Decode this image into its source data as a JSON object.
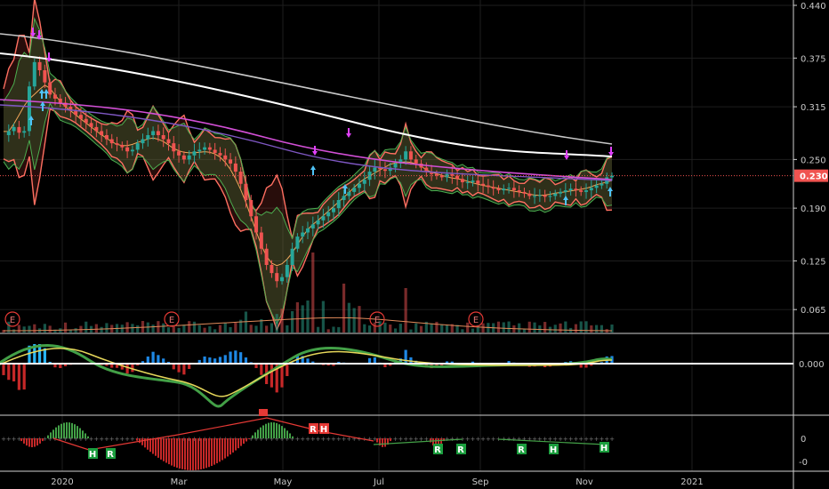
{
  "chart_data": {
    "type": "candlestick",
    "symbol_note": "",
    "price_axis": {
      "ticks": [
        "0.440",
        "0.375",
        "0.315",
        "0.250",
        "0.190",
        "0.125",
        "0.065"
      ],
      "ylim": [
        0.04,
        0.44
      ]
    },
    "last_price": {
      "label": "0.230",
      "value": 0.23,
      "color": "#f05350"
    },
    "time_axis": {
      "labels": [
        "2020",
        "Mar",
        "May",
        "Jul",
        "Sep",
        "Nov",
        "2021"
      ]
    },
    "earnings_markers": {
      "label": "E",
      "count": 4
    },
    "macd_panel": {
      "zero_label": "0.000"
    },
    "osc_panel": {
      "ticks": [
        "0",
        "-0"
      ]
    },
    "signal_tags": [
      {
        "label": "H",
        "color": "#1b9e3e"
      },
      {
        "label": "R",
        "color": "#1b9e3e"
      },
      {
        "label": "R",
        "color": "#e53935"
      },
      {
        "label": "H",
        "color": "#e53935"
      },
      {
        "label": "R",
        "color": "#1b9e3e"
      },
      {
        "label": "R",
        "color": "#1b9e3e"
      },
      {
        "label": "R",
        "color": "#1b9e3e"
      },
      {
        "label": "H",
        "color": "#1b9e3e"
      },
      {
        "label": "H",
        "color": "#1b9e3e"
      }
    ],
    "series": [
      {
        "role": "ma-long",
        "color": "#c8c8c8"
      },
      {
        "role": "ma-mid",
        "color": "#ffffff"
      },
      {
        "role": "ma-magenta",
        "color": "#d24fd6"
      },
      {
        "role": "ma-violet",
        "color": "#7e57c2"
      },
      {
        "role": "bollinger-upper",
        "color": "#4caf50"
      },
      {
        "role": "bollinger-lower",
        "color": "#4caf50"
      },
      {
        "role": "envelope",
        "color": "#ff6f61"
      }
    ],
    "closes": [
      0.28,
      0.285,
      0.29,
      0.283,
      0.285,
      0.34,
      0.37,
      0.36,
      0.345,
      0.33,
      0.325,
      0.32,
      0.315,
      0.31,
      0.305,
      0.3,
      0.295,
      0.29,
      0.285,
      0.28,
      0.275,
      0.27,
      0.268,
      0.265,
      0.26,
      0.262,
      0.27,
      0.275,
      0.28,
      0.285,
      0.28,
      0.275,
      0.27,
      0.26,
      0.255,
      0.25,
      0.255,
      0.26,
      0.262,
      0.265,
      0.262,
      0.258,
      0.255,
      0.25,
      0.245,
      0.235,
      0.22,
      0.2,
      0.18,
      0.16,
      0.14,
      0.12,
      0.11,
      0.1,
      0.105,
      0.12,
      0.14,
      0.155,
      0.16,
      0.165,
      0.17,
      0.175,
      0.18,
      0.185,
      0.19,
      0.2,
      0.205,
      0.21,
      0.215,
      0.22,
      0.225,
      0.235,
      0.24,
      0.238,
      0.236,
      0.24,
      0.245,
      0.25,
      0.26,
      0.25,
      0.245,
      0.24,
      0.235,
      0.232,
      0.23,
      0.228,
      0.232,
      0.23,
      0.226,
      0.222,
      0.222,
      0.224,
      0.22,
      0.218,
      0.216,
      0.214,
      0.212,
      0.214,
      0.215,
      0.212,
      0.21,
      0.208,
      0.205,
      0.205,
      0.206,
      0.204,
      0.205,
      0.208,
      0.21,
      0.212,
      0.214,
      0.212,
      0.21,
      0.212,
      0.215,
      0.218,
      0.22,
      0.228,
      0.23
    ]
  }
}
